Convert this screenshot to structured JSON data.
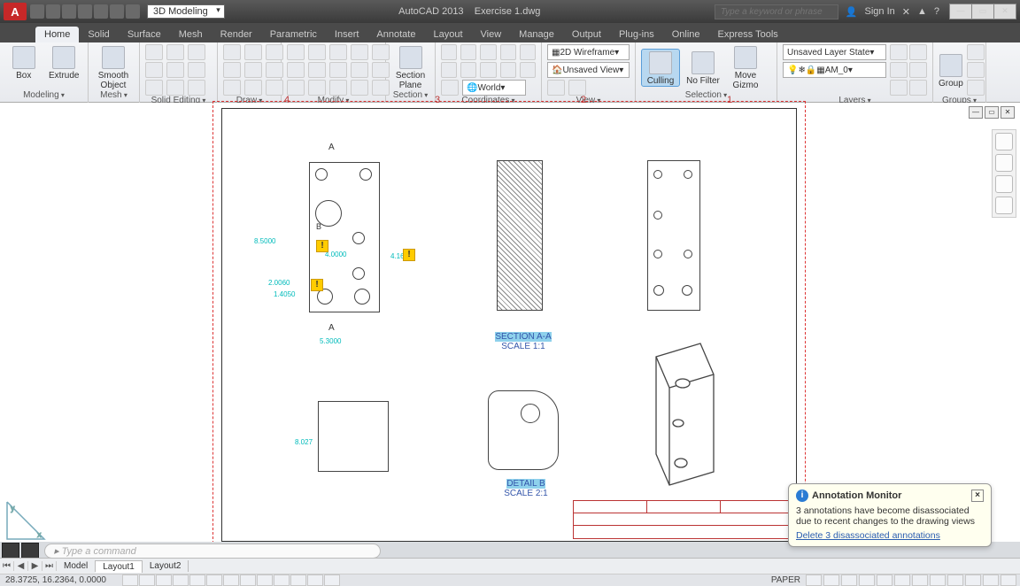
{
  "title": {
    "app": "AutoCAD 2013",
    "file": "Exercise 1.dwg"
  },
  "workspace_dropdown": "3D Modeling",
  "search_placeholder": "Type a keyword or phrase",
  "signin": "Sign In",
  "ribbon_tabs": [
    "Home",
    "Solid",
    "Surface",
    "Mesh",
    "Render",
    "Parametric",
    "Insert",
    "Annotate",
    "Layout",
    "View",
    "Manage",
    "Output",
    "Plug-ins",
    "Online",
    "Express Tools"
  ],
  "ribbon_active": 0,
  "panels": {
    "modeling": {
      "label": "Modeling",
      "box": "Box",
      "extrude": "Extrude"
    },
    "mesh": {
      "label": "Mesh",
      "smooth": "Smooth Object"
    },
    "solidedit": {
      "label": "Solid Editing"
    },
    "draw": {
      "label": "Draw"
    },
    "modify": {
      "label": "Modify"
    },
    "section": {
      "label": "Section",
      "plane": "Section Plane"
    },
    "coords": {
      "label": "Coordinates",
      "world": "World"
    },
    "view": {
      "label": "View",
      "style": "2D Wireframe",
      "unsaved": "Unsaved View"
    },
    "selection": {
      "label": "Selection",
      "culling": "Culling",
      "nofilter": "No Filter",
      "movegizmo": "Move Gizmo"
    },
    "layers": {
      "label": "Layers",
      "state": "Unsaved Layer State",
      "current": "AM_0"
    },
    "groups": {
      "label": "Groups",
      "group": "Group"
    }
  },
  "drawing": {
    "top_numbers": [
      "4",
      "3",
      "2",
      "1"
    ],
    "section_a": {
      "title": "SECTION A-A",
      "scale": "SCALE 1:1"
    },
    "detail_b": {
      "title": "DETAIL B",
      "scale": "SCALE 2:1"
    },
    "markers": {
      "a_top": "A",
      "a_bot": "A",
      "b": "B"
    },
    "dims": {
      "d1": "8.5000",
      "d2": "2.0060",
      "d3": "1.4050",
      "d4": "5.3000",
      "d5": "4.0000",
      "d6": "4.1630",
      "d7": "8.027"
    }
  },
  "annot": {
    "title": "Annotation Monitor",
    "msg": "3 annotations have become disassociated due to recent changes to the drawing views",
    "link": "Delete 3 disassociated annotations"
  },
  "cmd_placeholder": "Type a command",
  "model_tabs": [
    "Model",
    "Layout1",
    "Layout2"
  ],
  "status": {
    "coords": "28.3725, 16.2364, 0.0000",
    "space": "PAPER"
  }
}
